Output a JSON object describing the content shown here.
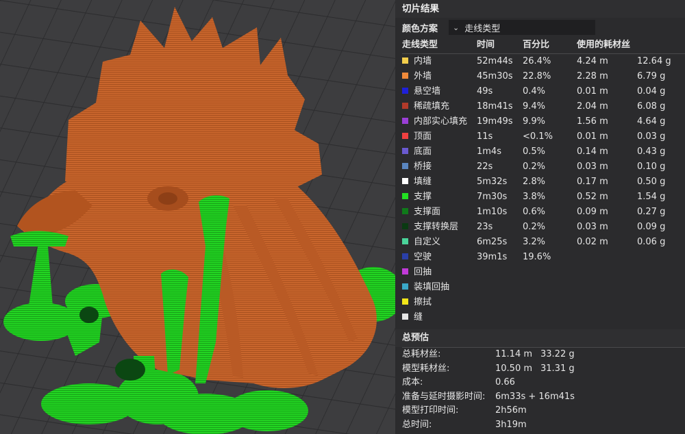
{
  "panel": {
    "title": "切片结果",
    "color_scheme": {
      "label": "颜色方案",
      "value": "走线类型"
    },
    "columns": {
      "type": "走线类型",
      "time": "时间",
      "percent": "百分比",
      "filament": "使用的耗材丝"
    },
    "rows": [
      {
        "color": "#f2cd4c",
        "name": "内墙",
        "time": "52m44s",
        "percent": "26.4%",
        "length": "4.24 m",
        "weight": "12.64 g"
      },
      {
        "color": "#f08a3a",
        "name": "外墙",
        "time": "45m30s",
        "percent": "22.8%",
        "length": "2.28 m",
        "weight": "6.79 g"
      },
      {
        "color": "#1f20d8",
        "name": "悬空墙",
        "time": "49s",
        "percent": "0.4%",
        "length": "0.01 m",
        "weight": "0.04 g"
      },
      {
        "color": "#b23a2a",
        "name": "稀疏填充",
        "time": "18m41s",
        "percent": "9.4%",
        "length": "2.04 m",
        "weight": "6.08 g"
      },
      {
        "color": "#9a3fd6",
        "name": "内部实心填充",
        "time": "19m49s",
        "percent": "9.9%",
        "length": "1.56 m",
        "weight": "4.64 g"
      },
      {
        "color": "#f04040",
        "name": "顶面",
        "time": "11s",
        "percent": "<0.1%",
        "length": "0.01 m",
        "weight": "0.03 g"
      },
      {
        "color": "#6a5ad0",
        "name": "底面",
        "time": "1m4s",
        "percent": "0.5%",
        "length": "0.14 m",
        "weight": "0.43 g"
      },
      {
        "color": "#5a86c0",
        "name": "桥接",
        "time": "22s",
        "percent": "0.2%",
        "length": "0.03 m",
        "weight": "0.10 g"
      },
      {
        "color": "#ffffff",
        "name": "填缝",
        "time": "5m32s",
        "percent": "2.8%",
        "length": "0.17 m",
        "weight": "0.50 g"
      },
      {
        "color": "#22e022",
        "name": "支撑",
        "time": "7m30s",
        "percent": "3.8%",
        "length": "0.52 m",
        "weight": "1.54 g"
      },
      {
        "color": "#0f7a1a",
        "name": "支撑面",
        "time": "1m10s",
        "percent": "0.6%",
        "length": "0.09 m",
        "weight": "0.27 g"
      },
      {
        "color": "#0a3a12",
        "name": "支撑转换层",
        "time": "23s",
        "percent": "0.2%",
        "length": "0.03 m",
        "weight": "0.09 g"
      },
      {
        "color": "#4ad39a",
        "name": "自定义",
        "time": "6m25s",
        "percent": "3.2%",
        "length": "0.02 m",
        "weight": "0.06 g"
      },
      {
        "color": "#2a3fa8",
        "name": "空驶",
        "time": "39m1s",
        "percent": "19.6%",
        "length": "",
        "weight": ""
      },
      {
        "color": "#c13ad8",
        "name": "回抽",
        "time": "",
        "percent": "",
        "length": "",
        "weight": ""
      },
      {
        "color": "#3aa8c8",
        "name": "装填回抽",
        "time": "",
        "percent": "",
        "length": "",
        "weight": ""
      },
      {
        "color": "#f2e61a",
        "name": "擦拭",
        "time": "",
        "percent": "",
        "length": "",
        "weight": ""
      },
      {
        "color": "#e6e6e6",
        "name": "缝",
        "time": "",
        "percent": "",
        "length": "",
        "weight": ""
      }
    ],
    "summary": {
      "title": "总预估",
      "rows": [
        {
          "label": "总耗材丝:",
          "v1": "11.14 m",
          "v2": "33.22 g"
        },
        {
          "label": "模型耗材丝:",
          "v1": "10.50 m",
          "v2": "31.31 g"
        },
        {
          "label": "成本:",
          "v1": "0.66",
          "v2": ""
        },
        {
          "label": "准备与延时摄影时间:",
          "v1": "6m33s + 16m41s",
          "v2": ""
        },
        {
          "label": "模型打印时间:",
          "v1": "2h56m",
          "v2": ""
        },
        {
          "label": "总时间:",
          "v1": "3h19m",
          "v2": ""
        }
      ]
    }
  }
}
